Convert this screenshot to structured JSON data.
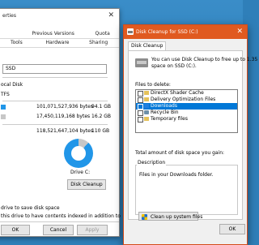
{
  "properties": {
    "title": "erties",
    "tabs_row1": [
      "Previous Versions",
      "Quota"
    ],
    "tabs_row2": [
      "Tools",
      "Hardware",
      "Sharing"
    ],
    "drive_name": "SSD",
    "type_label": "ocal Disk",
    "fs_label": "TFS",
    "used_bytes": "101,071,527,936 bytes",
    "used_gb": "94.1 GB",
    "free_bytes": "17,450,119,168 bytes",
    "free_gb": "16.2 GB",
    "capacity_bytes": "118,521,647,104 bytes",
    "capacity_gb": "110 GB",
    "drive_label": "Drive C:",
    "disk_cleanup_button": "Disk Cleanup",
    "compress_text": "drive to save disk space",
    "index_text": "this drive to have contents indexed in addition to",
    "ok_button": "OK",
    "cancel_button": "Cancel",
    "apply_button": "Apply",
    "colors": {
      "used": "#2196e8",
      "free": "#c7c7c7"
    }
  },
  "disk_cleanup": {
    "title": "Disk Cleanup for SSD (C:)",
    "tab": "Disk Cleanup",
    "intro_line1": "You can use Disk Cleanup to free up to 1.35",
    "intro_line2": "space on SSD (C:).",
    "files_to_delete_label": "Files to delete:",
    "items": [
      {
        "label": "DirectX Shader Cache",
        "checked": false,
        "selected": false,
        "icon": "folder-icon"
      },
      {
        "label": "Delivery Optimization Files",
        "checked": false,
        "selected": false,
        "icon": "folder-icon"
      },
      {
        "label": "Downloads",
        "checked": false,
        "selected": true,
        "icon": "download-icon"
      },
      {
        "label": "Recycle Bin",
        "checked": false,
        "selected": false,
        "icon": "recycle-bin-icon"
      },
      {
        "label": "Temporary files",
        "checked": false,
        "selected": false,
        "icon": "folder-icon"
      }
    ],
    "total_label": "Total amount of disk space you gain:",
    "description_label": "Description",
    "description_text": "Files in your Downloads folder.",
    "cleanup_system_button": "Clean up system files",
    "ok_button": "OK",
    "accent": "#e05a20",
    "selection_color": "#0078d7"
  }
}
